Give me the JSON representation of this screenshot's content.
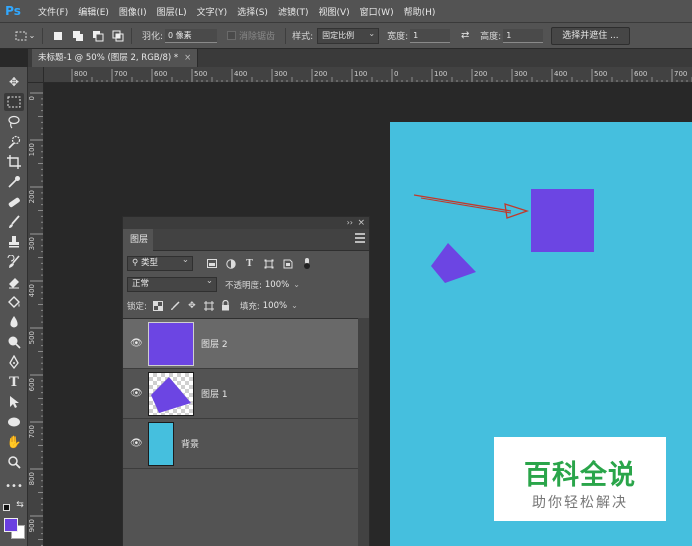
{
  "app": {
    "logo": "Ps"
  },
  "menu": {
    "items": [
      "文件(F)",
      "编辑(E)",
      "图像(I)",
      "图层(L)",
      "文字(Y)",
      "选择(S)",
      "滤镜(T)",
      "视图(V)",
      "窗口(W)",
      "帮助(H)"
    ]
  },
  "options": {
    "feather_label": "羽化:",
    "feather_value": "0 像素",
    "antialias_label": "消除锯齿",
    "style_label": "样式:",
    "style_value": "固定比例",
    "width_label": "宽度:",
    "width_value": "1",
    "height_label": "高度:",
    "height_value": "1",
    "select_mask_button": "选择并遮住 ..."
  },
  "document_tab": {
    "title": "未标题-1 @ 50% (图层 2, RGB/8) *",
    "close": "×"
  },
  "rulers": {
    "h_labels": [
      "800",
      "700",
      "600",
      "500",
      "400",
      "300",
      "200",
      "100",
      "0",
      "100",
      "200",
      "300",
      "400",
      "500",
      "600",
      "700",
      "800"
    ],
    "v_labels": [
      "0",
      "100",
      "200",
      "300",
      "400",
      "500",
      "600",
      "700",
      "800",
      "900"
    ]
  },
  "canvas": {
    "document_color": "#45bfde",
    "shape_color": "#6c45e3",
    "arrow_color": "#c0392b"
  },
  "layers_panel": {
    "tab_label": "图层",
    "collapse_icon": "››",
    "close_icon": "×",
    "filter_kind": "类型",
    "blend_mode": "正常",
    "opacity_label": "不透明度:",
    "opacity_value": "100%",
    "lock_label": "锁定:",
    "fill_label": "填充:",
    "fill_value": "100%",
    "layers": [
      {
        "name": "图层 2",
        "selected": true,
        "eye": "👁"
      },
      {
        "name": "图层 1",
        "selected": false,
        "eye": "👁"
      },
      {
        "name": "背景",
        "selected": false,
        "eye": "👁"
      }
    ]
  },
  "colors": {
    "foreground": "#6a3fe0",
    "background": "#ffffff"
  },
  "watermark": {
    "title": "百科全说",
    "subtitle": "助你轻松解决"
  }
}
